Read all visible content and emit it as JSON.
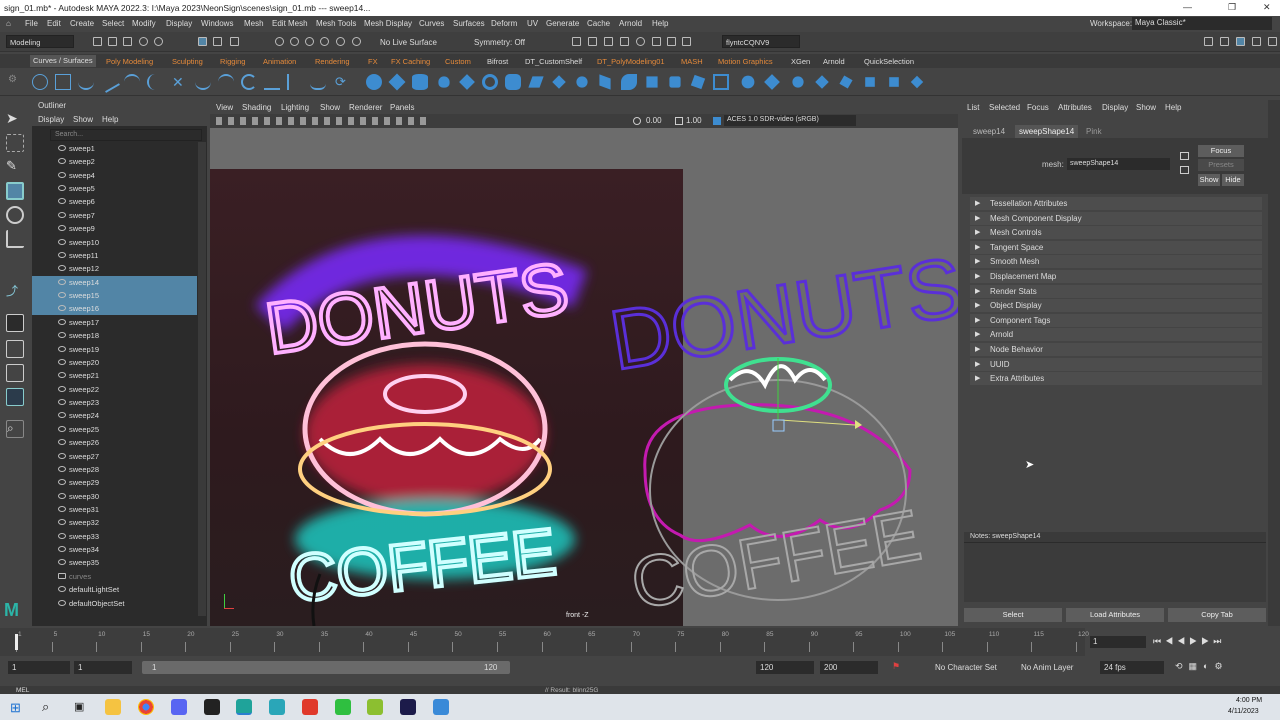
{
  "title_bar": {
    "text": "sign_01.mb* - Autodesk MAYA 2022.3: I:\\Maya 2023\\NeonSign\\scenes\\sign_01.mb   ---   sweep14..."
  },
  "menu": [
    "File",
    "Edit",
    "Create",
    "Select",
    "Modify",
    "Display",
    "Windows",
    "Mesh",
    "Edit Mesh",
    "Mesh Tools",
    "Mesh Display",
    "Curves",
    "Surfaces",
    "Deform",
    "UV",
    "Generate",
    "Cache",
    "Arnold",
    "Help"
  ],
  "workspace": {
    "label": "Workspace:",
    "value": "Maya Classic*"
  },
  "status_line": {
    "mode": "Modeling",
    "live_surface": "No Live Surface",
    "symmetry": "Symmetry: Off",
    "user": "flyntcCQNV9"
  },
  "shelf_tabs": [
    "Curves / Surfaces",
    "Poly Modeling",
    "Sculpting",
    "Rigging",
    "Animation",
    "Rendering",
    "FX",
    "FX Caching",
    "Custom",
    "Bifrost",
    "DT_CustomShelf",
    "DT_PolyModeling01",
    "MASH",
    "Motion Graphics",
    "XGen",
    "Arnold",
    "QuickSelection"
  ],
  "outliner": {
    "title": "Outliner",
    "menu": [
      "Display",
      "Show",
      "Help"
    ],
    "search_placeholder": "Search...",
    "items": [
      "sweep1",
      "sweep2",
      "sweep4",
      "sweep5",
      "sweep6",
      "sweep7",
      "sweep9",
      "sweep10",
      "sweep11",
      "sweep12",
      "sweep14",
      "sweep15",
      "sweep16",
      "sweep17",
      "sweep18",
      "sweep19",
      "sweep20",
      "sweep21",
      "sweep22",
      "sweep23",
      "sweep24",
      "sweep25",
      "sweep26",
      "sweep27",
      "sweep28",
      "sweep29",
      "sweep30",
      "sweep31",
      "sweep32",
      "sweep33",
      "sweep34",
      "sweep35",
      "curves",
      "defaultLightSet",
      "defaultObjectSet"
    ],
    "selected": [
      "sweep14",
      "sweep15",
      "sweep16"
    ]
  },
  "viewport": {
    "menu": [
      "View",
      "Shading",
      "Lighting",
      "Show",
      "Renderer",
      "Panels"
    ],
    "exposure": "0.00",
    "gamma": "1.00",
    "color_space": "ACES 1.0 SDR-video (sRGB)",
    "camera_label": "front -Z",
    "sign_top": "DONUTS",
    "sign_bottom": "COFFEE"
  },
  "attribute_editor": {
    "menu": [
      "List",
      "Selected",
      "Focus",
      "Attributes",
      "Display",
      "Show",
      "Help"
    ],
    "tabs": [
      "sweep14",
      "sweepShape14",
      "Pink"
    ],
    "mesh_label": "mesh:",
    "mesh_value": "sweepShape14",
    "focus": "Focus",
    "presets": "Presets",
    "show": "Show",
    "hide": "Hide",
    "sections": [
      "Tessellation Attributes",
      "Mesh Component Display",
      "Mesh Controls",
      "Tangent Space",
      "Smooth Mesh",
      "Displacement Map",
      "Render Stats",
      "Object Display",
      "Component Tags",
      "Arnold",
      "Node Behavior",
      "UUID",
      "Extra Attributes"
    ],
    "notes": "Notes:  sweepShape14",
    "buttons": {
      "select": "Select",
      "load": "Load Attributes",
      "copy": "Copy Tab"
    }
  },
  "timeline": {
    "ticks": [
      "1",
      "5",
      "10",
      "15",
      "20",
      "25",
      "30",
      "35",
      "40",
      "45",
      "50",
      "55",
      "60",
      "65",
      "70",
      "75",
      "80",
      "85",
      "90",
      "95",
      "100",
      "105",
      "110",
      "115",
      "120"
    ],
    "current_frame": "1"
  },
  "range": {
    "start": "1",
    "start2": "1",
    "slider_start": "1",
    "slider_end": "120",
    "end": "120",
    "end2": "200",
    "character_set": "No Character Set",
    "anim_layer": "No Anim Layer",
    "fps": "24 fps"
  },
  "command_line": {
    "lang": "MEL",
    "result": "// Result: blinn25G"
  },
  "taskbar": {
    "time": "4:00 PM",
    "date": "4/11/2023"
  }
}
